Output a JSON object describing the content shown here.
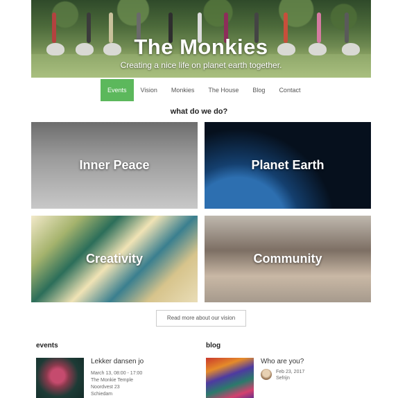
{
  "hero": {
    "title": "The Monkies",
    "subtitle": "Creating a nice life on planet earth together."
  },
  "nav": {
    "items": [
      {
        "label": "Events",
        "active": true
      },
      {
        "label": "Vision",
        "active": false
      },
      {
        "label": "Monkies",
        "active": false
      },
      {
        "label": "The House",
        "active": false
      },
      {
        "label": "Blog",
        "active": false
      },
      {
        "label": "Contact",
        "active": false
      }
    ]
  },
  "section": {
    "title": "what do we do?"
  },
  "tiles": [
    {
      "label": "Inner Peace"
    },
    {
      "label": "Planet Earth"
    },
    {
      "label": "Creativity"
    },
    {
      "label": "Community"
    }
  ],
  "vision_button": {
    "label": "Read more about our vision"
  },
  "events": {
    "heading": "events",
    "item": {
      "title": "Lekker dansen jo",
      "date": "March 13, 08:00 - 17:00",
      "venue": "The Monkie Temple",
      "street": "Noordvest 23",
      "city": "Schiedam"
    }
  },
  "blog": {
    "heading": "blog",
    "item": {
      "title": "Who are you?",
      "date": "Feb 23, 2017",
      "author": "Sefrijn"
    }
  },
  "colors": {
    "accent": "#5cb85c"
  }
}
